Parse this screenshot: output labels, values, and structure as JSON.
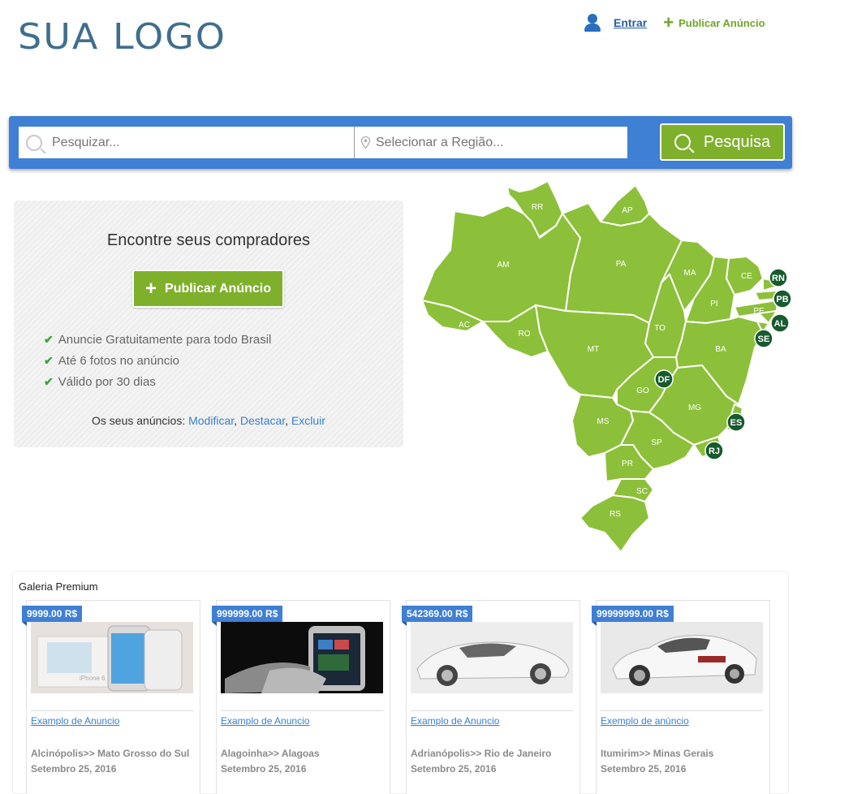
{
  "header": {
    "logo": "SUA LOGO",
    "login_label": "Entrar",
    "publish_label": "Publicar Anúncio"
  },
  "search": {
    "query_placeholder": "Pesquizar...",
    "region_placeholder": "Selecionar a Região...",
    "button_label": "Pesquisa"
  },
  "promo": {
    "title": "Encontre seus compradores",
    "button_label": "Publicar Anúncio",
    "features": [
      "Anuncie Gratuitamente para todo Brasil",
      "Até 6 fotos no anúncio",
      "Válido por 30 dias"
    ],
    "ads_prefix": "Os seus anúncios:",
    "ads_links": [
      "Modificar",
      "Destacar",
      "Excluir"
    ]
  },
  "map": {
    "states": [
      "RR",
      "AP",
      "AM",
      "PA",
      "MA",
      "CE",
      "RN",
      "PB",
      "PI",
      "PE",
      "AL",
      "SE",
      "AC",
      "RO",
      "TO",
      "MT",
      "BA",
      "DF",
      "GO",
      "MG",
      "ES",
      "MS",
      "SP",
      "RJ",
      "PR",
      "SC",
      "RS"
    ],
    "colors": {
      "state": "#8dc03a",
      "badge": "#175a2e"
    }
  },
  "gallery": {
    "title": "Galeria Premium",
    "items": [
      {
        "price": "9999.00 R$",
        "title": "Examplo de Anuncio",
        "location": "Alcinópolis>> Mato Grosso do Sul",
        "date": "Setembro 25, 2016",
        "image": "iphone-box-image"
      },
      {
        "price": "999999.00 R$",
        "title": "Examplo de Anuncio",
        "location": "Alagoinha>> Alagoas",
        "date": "Setembro 25, 2016",
        "image": "smartphone-image"
      },
      {
        "price": "542369.00 R$",
        "title": "Examplo de Anuncio",
        "location": "Adrianópolis>> Rio de Janeiro",
        "date": "Setembro 25, 2016",
        "image": "white-sports-car-image"
      },
      {
        "price": "99999999.00 R$",
        "title": "Exemplo de anúncio",
        "location": "Itumirim>> Minas Gerais",
        "date": "Setembro 25, 2016",
        "image": "white-sedan-image"
      }
    ]
  },
  "colors": {
    "primary_blue": "#3f7fd4",
    "accent_green": "#7fb02c",
    "link_blue": "#3a7fcf"
  }
}
